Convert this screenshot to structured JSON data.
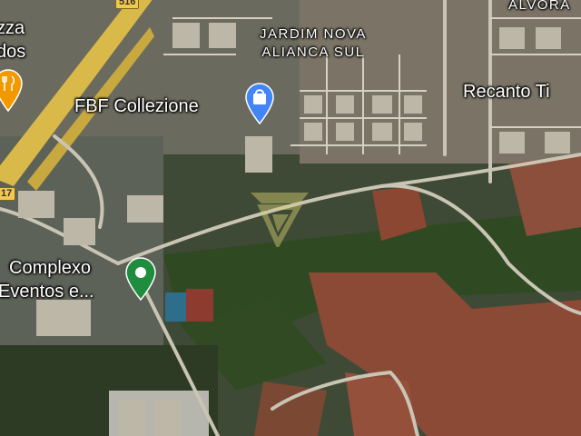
{
  "labels": {
    "neighborhood_line1": "JARDIM NOVA",
    "neighborhood_line2": "ALIANCA SUL",
    "alvorada_partial": "ALVORA",
    "store": "FBF Collezione",
    "recanto": "Recanto Ti",
    "complexo_line1": "Complexo",
    "complexo_line2": "Eventos e...",
    "pizza_partial": "zza",
    "dos_partial": "dos"
  },
  "road_shields": {
    "top": "516",
    "left": "17"
  },
  "pins": {
    "shopping": {
      "icon": "shopping-bag-icon",
      "color": "#4285f4"
    },
    "event": {
      "icon": "event-venue-icon",
      "color": "#1e8e3e"
    },
    "food": {
      "icon": "restaurant-icon",
      "color": "#f29900"
    }
  },
  "watermark": {
    "icon": "watermark-logo-icon"
  }
}
